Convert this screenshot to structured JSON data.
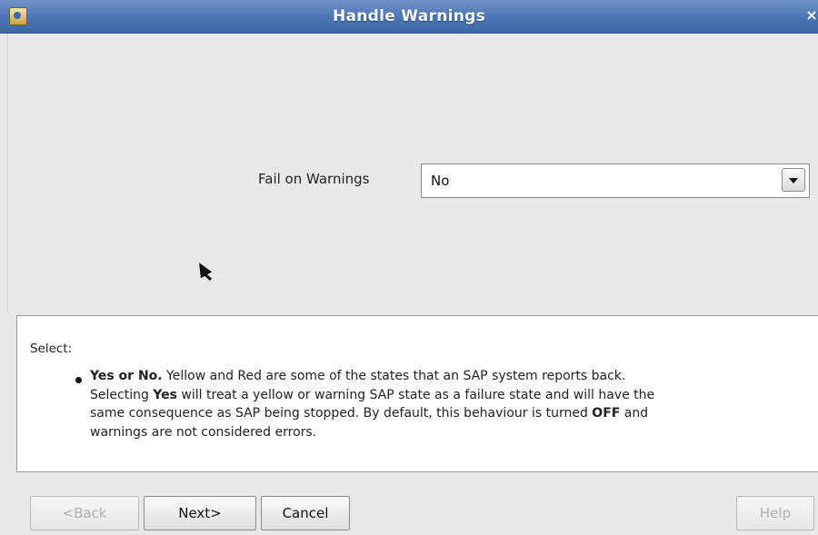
{
  "window": {
    "title": "Handle Warnings",
    "close_glyph": "×",
    "app_icon": "java-app-icon",
    "title_bar_color": "#4a74b2"
  },
  "form": {
    "fail_on_warnings_label": "Fail on Warnings",
    "fail_on_warnings_value": "No"
  },
  "help": {
    "heading": "Select:",
    "bullet_bold": "Yes or No.",
    "line1_rest": " Yellow and Red are some of the states that an SAP system reports back.",
    "line2_pre": "Selecting ",
    "line2_bold": "Yes",
    "line2_rest": " will treat a yellow or warning SAP state as a failure state and will have the",
    "line3_pre": "same consequence as SAP being stopped. By default, this behaviour is turned ",
    "line3_bold": "OFF",
    "line3_post": " and",
    "line4": "warnings are not considered errors."
  },
  "buttons": {
    "back": "<Back",
    "next": "Next>",
    "cancel": "Cancel",
    "help": "Help"
  }
}
